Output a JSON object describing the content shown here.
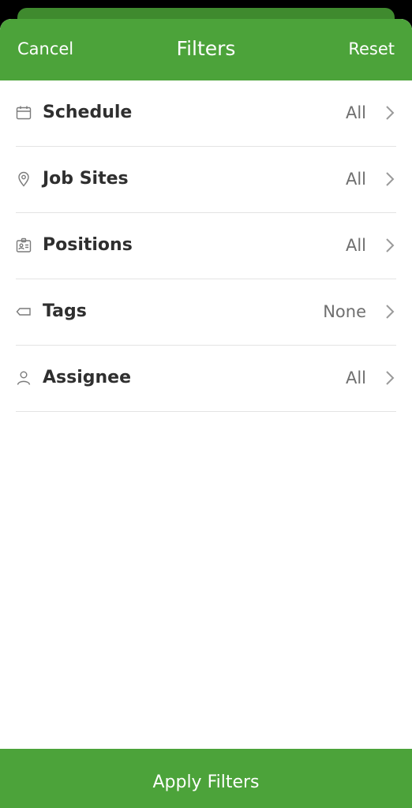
{
  "header": {
    "cancel_label": "Cancel",
    "title": "Filters",
    "reset_label": "Reset"
  },
  "filters": [
    {
      "label": "Schedule",
      "value": "All",
      "icon": "calendar-icon"
    },
    {
      "label": "Job Sites",
      "value": "All",
      "icon": "location-pin-icon"
    },
    {
      "label": "Positions",
      "value": "All",
      "icon": "id-badge-icon"
    },
    {
      "label": "Tags",
      "value": "None",
      "icon": "tag-icon"
    },
    {
      "label": "Assignee",
      "value": "All",
      "icon": "person-icon"
    }
  ],
  "footer": {
    "apply_label": "Apply Filters"
  },
  "colors": {
    "brand_green": "#4ca33a",
    "text_dark": "#2f2f2f",
    "text_muted": "#6f6f6f"
  }
}
